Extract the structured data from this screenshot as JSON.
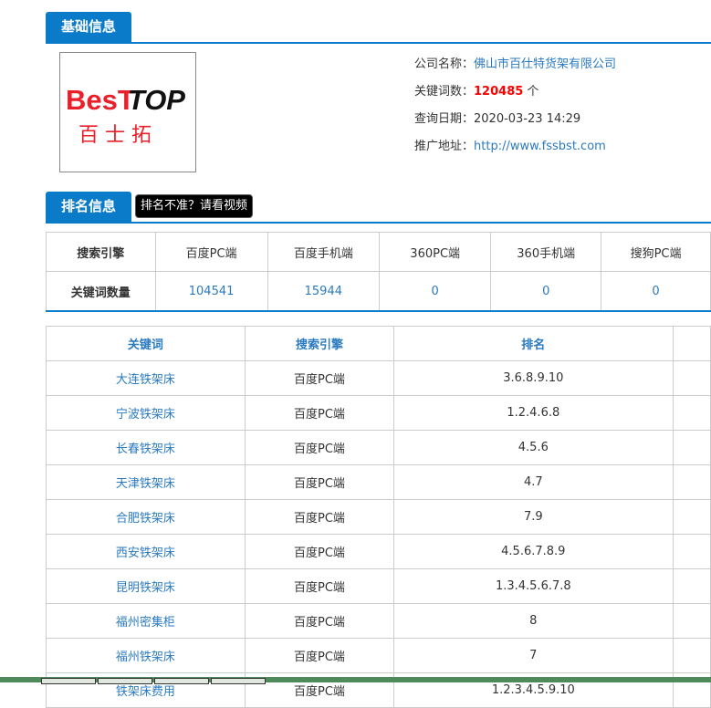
{
  "basic": {
    "title": "基础信息",
    "logo": {
      "text_red": "BesT",
      "text_black": "TOP",
      "cn": "百 士 拓"
    },
    "company_label": "公司名称：",
    "company": "佛山市百仕特货架有限公司",
    "kw_label": "关键词数：",
    "kw_count": "120485",
    "kw_unit": " 个",
    "date_label": "查询日期：",
    "date": "2020-03-23 14:29",
    "url_label": "推广地址：",
    "url": "http://www.fssbst.com"
  },
  "ranking": {
    "title": "排名信息",
    "badge": "排名不准？请看视频",
    "engine_label": "搜索引擎",
    "count_label": "关键词数量",
    "engines": [
      {
        "name": "百度PC端",
        "count": "104541"
      },
      {
        "name": "百度手机端",
        "count": "15944"
      },
      {
        "name": "360PC端",
        "count": "0"
      },
      {
        "name": "360手机端",
        "count": "0"
      },
      {
        "name": "搜狗PC端",
        "count": "0"
      }
    ]
  },
  "keywords": {
    "headers": [
      "关键词",
      "搜索引擎",
      "排名"
    ],
    "rows": [
      [
        "大连铁架床",
        "百度PC端",
        "3.6.8.9.10"
      ],
      [
        "宁波铁架床",
        "百度PC端",
        "1.2.4.6.8"
      ],
      [
        "长春铁架床",
        "百度PC端",
        "4.5.6"
      ],
      [
        "天津铁架床",
        "百度PC端",
        "4.7"
      ],
      [
        "合肥铁架床",
        "百度PC端",
        "7.9"
      ],
      [
        "西安铁架床",
        "百度PC端",
        "4.5.6.7.8.9"
      ],
      [
        "昆明铁架床",
        "百度PC端",
        "1.3.4.5.6.7.8"
      ],
      [
        "福州密集柜",
        "百度PC端",
        "8"
      ],
      [
        "福州铁架床",
        "百度PC端",
        "7"
      ],
      [
        "铁架床费用",
        "百度PC端",
        "1.2.3.4.5.9.10"
      ]
    ]
  }
}
